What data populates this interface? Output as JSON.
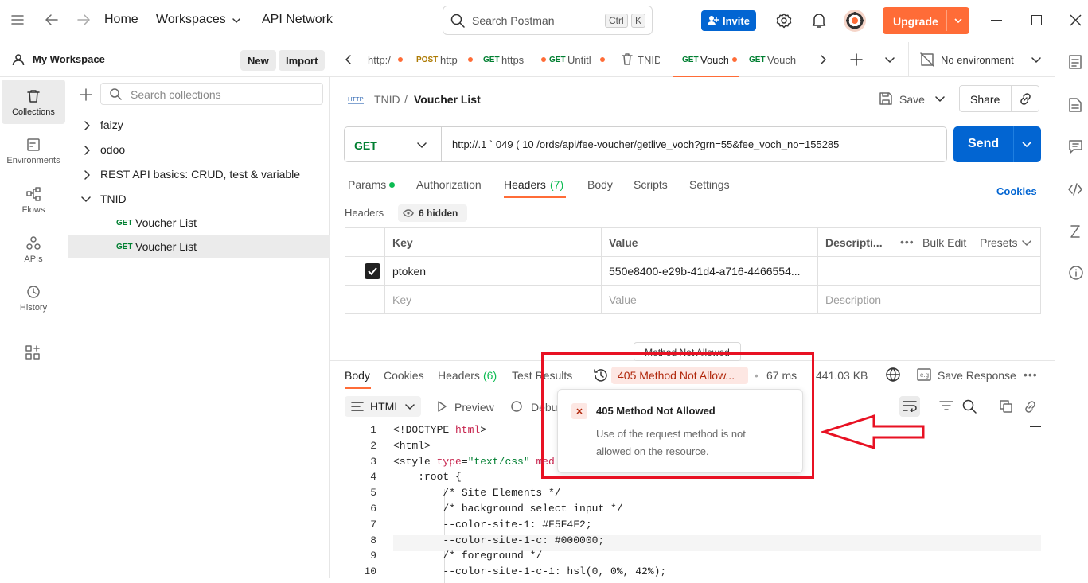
{
  "topbar": {
    "home": "Home",
    "workspaces": "Workspaces",
    "api_network": "API Network",
    "search_placeholder": "Search Postman",
    "kbd_ctrl": "Ctrl",
    "kbd_k": "K",
    "invite": "Invite",
    "upgrade": "Upgrade"
  },
  "sidebar": {
    "workspace_name": "My Workspace",
    "new_label": "New",
    "import_label": "Import",
    "search_placeholder": "Search collections",
    "nav": [
      {
        "label": "Collections"
      },
      {
        "label": "Environments"
      },
      {
        "label": "Flows"
      },
      {
        "label": "APIs"
      },
      {
        "label": "History"
      }
    ],
    "collections": [
      {
        "label": "faizy"
      },
      {
        "label": "odoo"
      },
      {
        "label": "REST API basics: CRUD, test & variable"
      },
      {
        "label": "TNID"
      }
    ],
    "requests": [
      {
        "method": "GET",
        "label": "Voucher List"
      },
      {
        "method": "GET",
        "label": "Voucher List"
      }
    ]
  },
  "tabs": [
    {
      "method": "",
      "label": "http:/"
    },
    {
      "method": "POST",
      "label": "http"
    },
    {
      "method": "GET",
      "label": "https"
    },
    {
      "method": "GET",
      "label": "Untitl"
    },
    {
      "method": "",
      "label": "TNID"
    },
    {
      "method": "GET",
      "label": "Vouch"
    },
    {
      "method": "GET",
      "label": "Vouch"
    }
  ],
  "environment": "No environment",
  "request": {
    "breadcrumb_parent": "TNID",
    "breadcrumb_sep": "/",
    "name": "Voucher List",
    "save": "Save",
    "share": "Share",
    "method": "GET",
    "url": "http://.1 ` 049 ( 10 /ords/api/fee-voucher/getlive_voch?grn=55&fee_voch_no=155285",
    "send": "Send",
    "tabs": {
      "params": "Params",
      "authorization": "Authorization",
      "headers": "Headers",
      "headers_count": "(7)",
      "body": "Body",
      "scripts": "Scripts",
      "settings": "Settings"
    },
    "cookies": "Cookies",
    "headers_label": "Headers",
    "hidden": "6 hidden",
    "table": {
      "key": "Key",
      "value": "Value",
      "description": "Descripti...",
      "bulk_edit": "Bulk Edit",
      "presets": "Presets",
      "row_key": "ptoken",
      "row_value": "550e8400-e29b-41d4-a716-4466554...",
      "ph_key": "Key",
      "ph_value": "Value",
      "ph_desc": "Description"
    }
  },
  "response": {
    "tooltip": "Method Not Allowed",
    "tabs": {
      "body": "Body",
      "cookies": "Cookies",
      "headers": "Headers",
      "headers_count": "(6)",
      "tests": "Test Results"
    },
    "status": "405 Method Not Allow...",
    "time": "67 ms",
    "size": "441.03 KB",
    "save_response": "Save Response",
    "format": "HTML",
    "preview": "Preview",
    "debug": "Debu",
    "popup_title": "405 Method Not Allowed",
    "popup_text_1": "Use of the request method is not",
    "popup_text_2": "allowed on the resource.",
    "lines": [
      {
        "n": "1",
        "parts": [
          {
            "t": "<!DOCTYPE ",
            "c": "#212121"
          },
          {
            "t": "html",
            "c": "#c7254e"
          },
          {
            "t": ">",
            "c": "#212121"
          }
        ]
      },
      {
        "n": "2",
        "parts": [
          {
            "t": "<html>",
            "c": "#212121"
          }
        ]
      },
      {
        "n": "3",
        "parts": [
          {
            "t": "<style ",
            "c": "#212121"
          },
          {
            "t": "type",
            "c": "#c7254e"
          },
          {
            "t": "=",
            "c": "#212121"
          },
          {
            "t": "\"text/css\"",
            "c": "#007f31"
          },
          {
            "t": " med",
            "c": "#c7254e"
          }
        ]
      },
      {
        "n": "4",
        "parts": [
          {
            "t": "    :root {",
            "c": "#212121"
          }
        ]
      },
      {
        "n": "5",
        "parts": [
          {
            "t": "        /* Site Elements */",
            "c": "#212121"
          }
        ]
      },
      {
        "n": "6",
        "parts": [
          {
            "t": "        /* background select input */",
            "c": "#212121"
          }
        ]
      },
      {
        "n": "7",
        "parts": [
          {
            "t": "        --color-site-1: #F5F4F2;",
            "c": "#212121"
          }
        ]
      },
      {
        "n": "8",
        "parts": [
          {
            "t": "        --color-site-1-c: #000000;",
            "c": "#212121"
          }
        ]
      },
      {
        "n": "9",
        "parts": [
          {
            "t": "        /* foreground */",
            "c": "#212121"
          }
        ]
      },
      {
        "n": "10",
        "parts": [
          {
            "t": "        --color-site-1-c-1: hsl(0, 0%, 42%);",
            "c": "#212121"
          }
        ]
      }
    ]
  }
}
